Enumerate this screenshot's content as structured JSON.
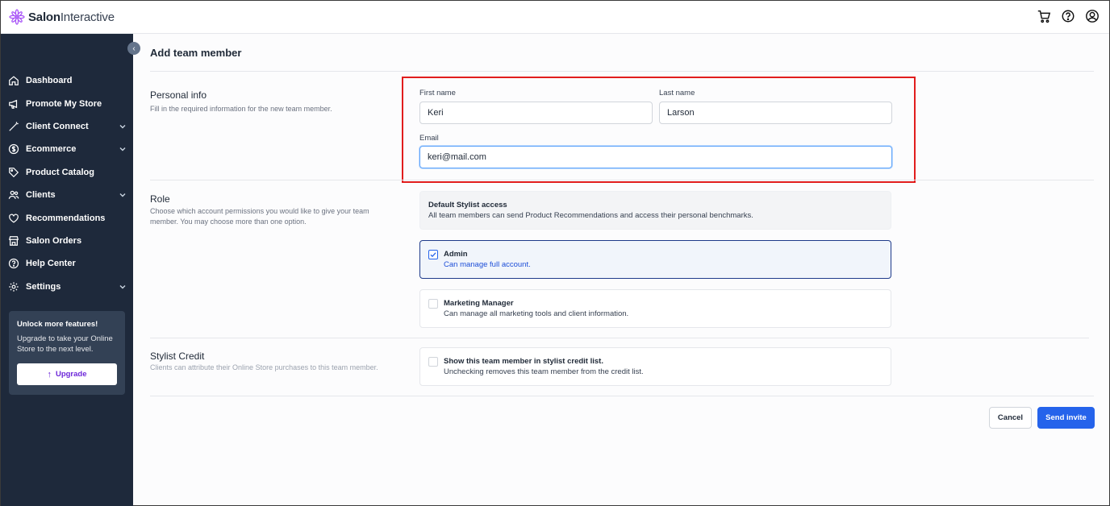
{
  "app": {
    "brand_bold": "Salon",
    "brand_light": "Interactive"
  },
  "sidebar": {
    "items": [
      {
        "label": "Dashboard",
        "icon": "home-icon",
        "expandable": false
      },
      {
        "label": "Promote My Store",
        "icon": "megaphone-icon",
        "expandable": false
      },
      {
        "label": "Client Connect",
        "icon": "wand-icon",
        "expandable": true
      },
      {
        "label": "Ecommerce",
        "icon": "dollar-icon",
        "expandable": true
      },
      {
        "label": "Product Catalog",
        "icon": "tag-icon",
        "expandable": false
      },
      {
        "label": "Clients",
        "icon": "users-icon",
        "expandable": true
      },
      {
        "label": "Recommendations",
        "icon": "heart-icon",
        "expandable": false
      },
      {
        "label": "Salon Orders",
        "icon": "store-icon",
        "expandable": false
      },
      {
        "label": "Help Center",
        "icon": "help-icon",
        "expandable": false
      },
      {
        "label": "Settings",
        "icon": "gear-icon",
        "expandable": true
      }
    ],
    "upgrade": {
      "title": "Unlock more features!",
      "text": "Upgrade to take your Online Store to the next level.",
      "button": "Upgrade"
    }
  },
  "main": {
    "title": "Add team member",
    "personal": {
      "title": "Personal info",
      "desc": "Fill in the required information for the new team member.",
      "first_name_label": "First name",
      "first_name_value": "Keri",
      "last_name_label": "Last name",
      "last_name_value": "Larson",
      "email_label": "Email",
      "email_value": "keri@mail.com"
    },
    "role": {
      "title": "Role",
      "desc": "Choose which account permissions you would like to give your team member. You may choose more than one option.",
      "default_title": "Default Stylist access",
      "default_desc": "All team members can send Product Recommendations and access their personal benchmarks.",
      "admin_title": "Admin",
      "admin_desc": "Can manage full account.",
      "admin_checked": true,
      "marketing_title": "Marketing Manager",
      "marketing_desc": "Can manage all marketing tools and client information.",
      "marketing_checked": false
    },
    "credit": {
      "title": "Stylist Credit",
      "desc": "Clients can attribute their Online Store purchases to this team member.",
      "option_title": "Show this team member in stylist credit list.",
      "option_desc": "Unchecking removes this team member from the credit list.",
      "checked": false
    },
    "actions": {
      "cancel": "Cancel",
      "submit": "Send invite"
    }
  },
  "colors": {
    "accent": "#2563eb",
    "sidebar_bg": "#1e293b",
    "highlight": "#e11d1d"
  }
}
